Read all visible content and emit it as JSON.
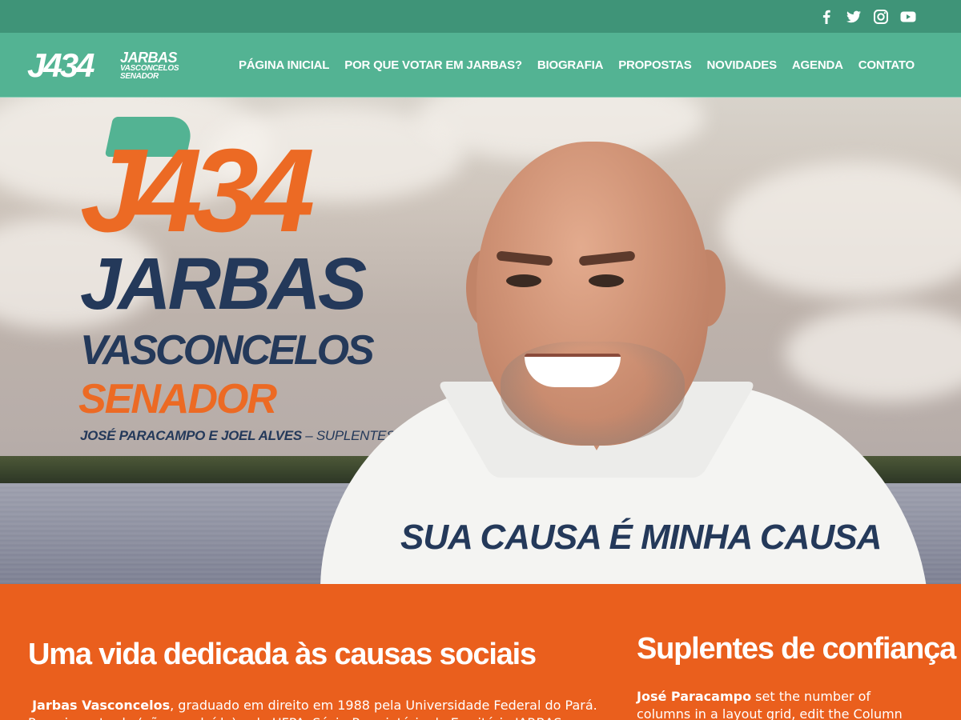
{
  "topbar": {
    "social": [
      {
        "icon": "facebook-icon",
        "name": "social-facebook-link"
      },
      {
        "icon": "twitter-icon",
        "name": "social-twitter-link"
      },
      {
        "icon": "instagram-icon",
        "name": "social-instagram-link"
      },
      {
        "icon": "youtube-icon",
        "name": "social-youtube-link"
      }
    ]
  },
  "header": {
    "logo": {
      "number": "J434",
      "name": "JARBAS",
      "surname": "VASCONCELOS",
      "role": "SENADOR"
    },
    "nav": [
      "PÁGINA INICIAL",
      "POR QUE VOTAR EM JARBAS?",
      "BIOGRAFIA",
      "PROPOSTAS",
      "NOVIDADES",
      "AGENDA",
      "CONTATO"
    ]
  },
  "hero": {
    "number": "J434",
    "name": "JARBAS",
    "surname": "VASCONCELOS",
    "role": "SENADOR",
    "suplentes_names": "JOSÉ PARACAMPO E JOEL ALVES",
    "suplentes_suffix": " – SUPLENTES",
    "slogan": "SUA CAUSA É MINHA CAUSA"
  },
  "content": {
    "left": {
      "title": "Uma vida dedicada às causas sociais",
      "para_bold": "Jarbas Vasconcelos",
      "para_text": ", graduado em direito em 1988 pela Universidade Federal do Pará. Possui mestrado (não  concluído) pela UFPA. Sócio-Proprietário do Escritório JARBAS VASCONCELOS"
    },
    "right": {
      "title": "Suplentes de confiança",
      "para_bold": "José Paracampo",
      "para_text": " set the number of columns in a layout grid, edit the Column value in the"
    }
  },
  "colors": {
    "topbar": "#3f9478",
    "navbar": "#53b393",
    "orange": "#ea5f1d",
    "navy": "#24395a",
    "hero_orange": "#ec6a24"
  }
}
